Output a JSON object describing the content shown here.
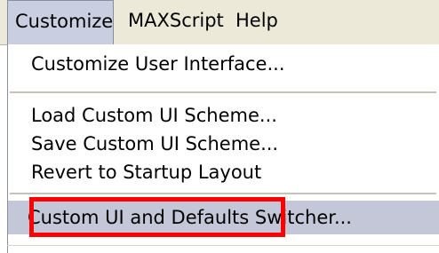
{
  "menubar": {
    "items": [
      {
        "label": "Customize"
      },
      {
        "label": "MAXScript"
      },
      {
        "label": "Help"
      }
    ]
  },
  "dropdown": {
    "items": [
      {
        "label": "Customize User Interface..."
      },
      {
        "label": "Load Custom UI Scheme..."
      },
      {
        "label": "Save Custom UI Scheme..."
      },
      {
        "label": "Revert to Startup Layout"
      },
      {
        "label": "Custom UI and Defaults Switcher..."
      }
    ]
  },
  "colors": {
    "menubar_bg": "#ece9d8",
    "active_menu_bg": "#c9cfe1",
    "hover_item_bg": "#c3c7d8",
    "highlight_border": "#ff0000"
  }
}
